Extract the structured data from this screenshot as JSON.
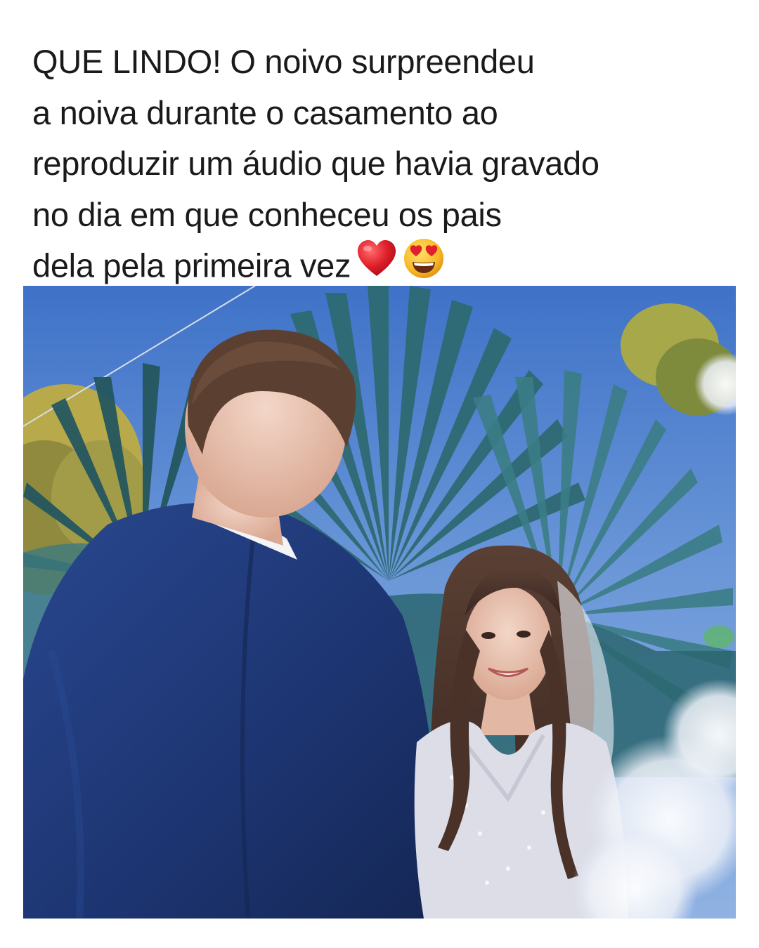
{
  "post": {
    "caption_lines": [
      "QUE LINDO! O noivo surpreendeu",
      "a noiva durante o casamento ao",
      "reproduzir um áudio que havia gravado",
      "no dia em que conheceu os pais",
      "dela pela primeira vez"
    ],
    "caption_emojis": [
      "red-heart-icon",
      "heart-eyes-face-icon"
    ],
    "photo": {
      "subject": "wedding-ceremony-photo"
    }
  },
  "colors": {
    "text": "#1a1a1a",
    "sky": "#5f8bd0",
    "palm": "#2f6b73",
    "suit": "#1e3570",
    "dress": "#dcdde6",
    "heart": "#e0202a",
    "emoji_face": "#f7b826"
  }
}
